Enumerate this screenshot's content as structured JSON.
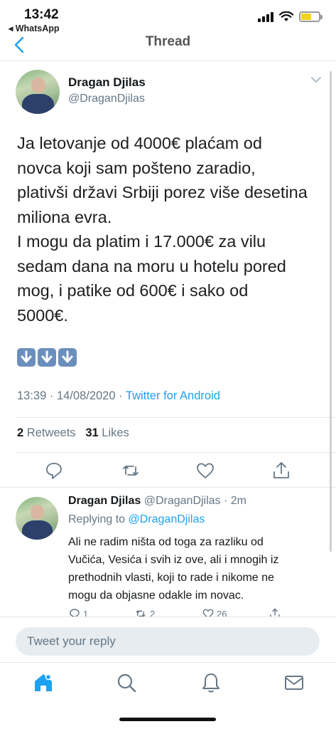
{
  "status_bar": {
    "time": "13:42",
    "back_app": "◂ WhatsApp"
  },
  "nav": {
    "title": "Thread"
  },
  "tweet": {
    "author_name": "Dragan Djilas",
    "author_handle": "@DraganDjilas",
    "text": "Ja letovanje od 4000€ plaćam od\nnovca koji sam pošteno zaradio,\nplativši državi Srbiji porez više desetina\nmiliona evra.\nI mogu da platim i 17.000€ za vilu\nsedam dana na moru u hotelu pored\nmog, i patike od 600€ i sako od\n5000€.",
    "emoji": [
      "down-arrow-icon",
      "down-arrow-icon",
      "down-arrow-icon"
    ],
    "time": "13:39 · 14/08/2020 · ",
    "source": "Twitter for Android",
    "retweets_count": "2",
    "retweets_label": "Retweets",
    "likes_count": "31",
    "likes_label": "Likes"
  },
  "reply": {
    "author_name": "Dragan Djilas",
    "author_meta": "@DraganDjilas · 2m",
    "replying_label": "Replying to ",
    "replying_to": "@DraganDjilas",
    "text": "Ali ne radim ništa od toga za razliku od\nVučića, Vesića i svih iz ove, ali i mnogih iz\nprethodnih vlasti, koji to rade i nikome ne\nmogu da objasne odakle im novac.",
    "reply_count": "1",
    "retweet_count": "2",
    "like_count": "26"
  },
  "compose": {
    "placeholder": "Tweet your reply"
  },
  "tabs": [
    "home-icon",
    "search-icon",
    "notifications-icon",
    "messages-icon"
  ],
  "colors": {
    "accent": "#1da1f2",
    "muted": "#657786",
    "emoji_box": "#6b8fbd"
  }
}
